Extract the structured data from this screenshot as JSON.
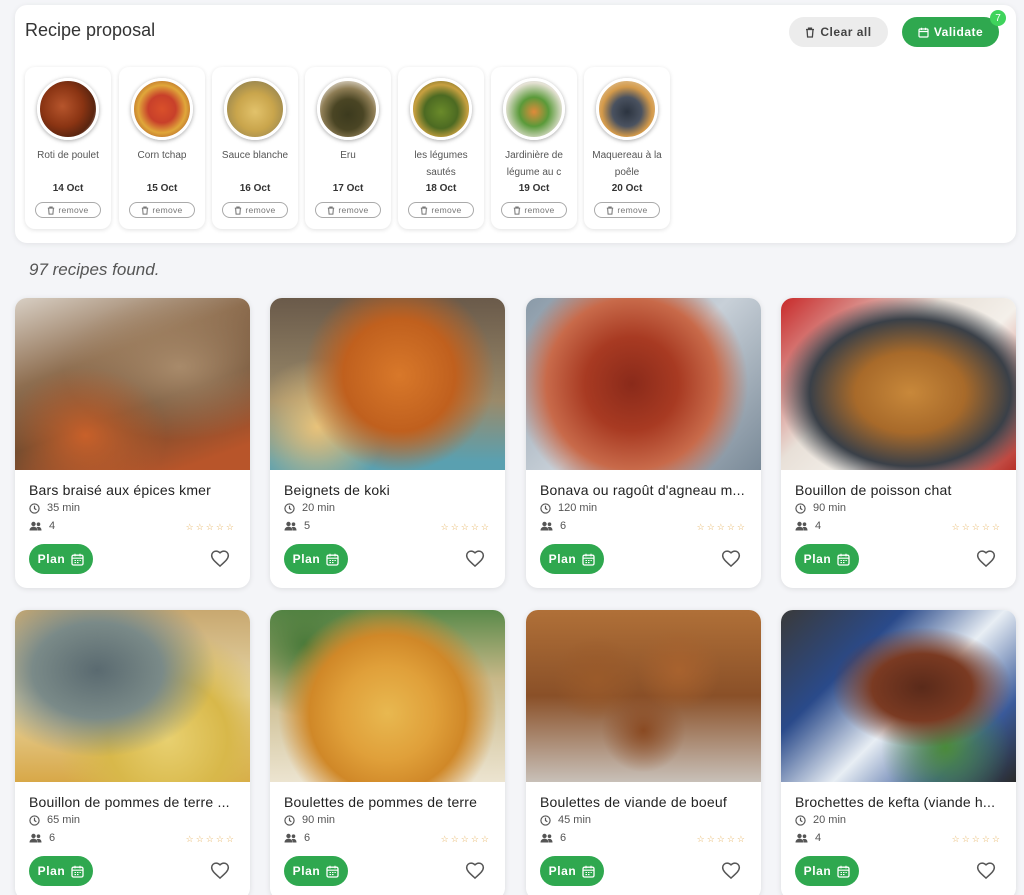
{
  "proposal": {
    "title": "Recipe proposal",
    "clear_label": "Clear all",
    "validate_label": "Validate",
    "count": "7",
    "items": [
      {
        "name": "Roti de poulet",
        "date": "14 Oct",
        "remove": "remove"
      },
      {
        "name": "Corn tchap",
        "date": "15 Oct",
        "remove": "remove"
      },
      {
        "name": "Sauce blanche",
        "date": "16 Oct",
        "remove": "remove"
      },
      {
        "name": "Eru",
        "date": "17 Oct",
        "remove": "remove"
      },
      {
        "name": "les légumes sautés",
        "date": "18 Oct",
        "remove": "remove"
      },
      {
        "name": "Jardinière de légume au c",
        "date": "19 Oct",
        "remove": "remove"
      },
      {
        "name": "Maquereau à la poêle",
        "date": "20 Oct",
        "remove": "remove"
      }
    ]
  },
  "results": {
    "count_text": "97 recipes found."
  },
  "recipes": [
    {
      "title": "Bars braisé aux épices kmer",
      "time": "35 min",
      "people": "4",
      "plan": "Plan",
      "rating": 0
    },
    {
      "title": "Beignets de koki",
      "time": "20 min",
      "people": "5",
      "plan": "Plan",
      "rating": 0
    },
    {
      "title": "Bonava ou ragoût d'agneau m...",
      "time": "120 min",
      "people": "6",
      "plan": "Plan",
      "rating": 0
    },
    {
      "title": "Bouillon de poisson chat",
      "time": "90 min",
      "people": "4",
      "plan": "Plan",
      "rating": 0
    },
    {
      "title": "Bouillon de pommes de terre ...",
      "time": "65 min",
      "people": "6",
      "plan": "Plan",
      "rating": 0
    },
    {
      "title": "Boulettes de pommes de terre",
      "time": "90 min",
      "people": "6",
      "plan": "Plan",
      "rating": 0
    },
    {
      "title": "Boulettes de viande de boeuf",
      "time": "45 min",
      "people": "6",
      "plan": "Plan",
      "rating": 0
    },
    {
      "title": "Brochettes de kefta (viande h...",
      "time": "20 min",
      "people": "4",
      "plan": "Plan",
      "rating": 0
    }
  ],
  "icons": {
    "trash": "trash-icon",
    "calendar": "calendar-icon",
    "clock": "clock-icon",
    "people": "people-icon",
    "heart": "heart-outline-icon",
    "star": "star-outline-icon"
  },
  "colors": {
    "accent": "#2fa84f",
    "badge": "#3fd35c",
    "star": "#e6b566"
  }
}
